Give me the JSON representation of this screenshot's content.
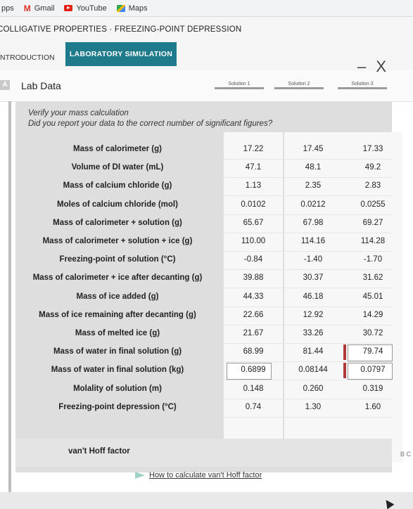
{
  "bookmarks": [
    {
      "label": "pps",
      "icon": "apps-icon"
    },
    {
      "label": "Gmail",
      "icon": "gmail-icon"
    },
    {
      "label": "YouTube",
      "icon": "youtube-icon"
    },
    {
      "label": "Maps",
      "icon": "maps-icon"
    }
  ],
  "app": {
    "title": "COLLIGATIVE PROPERTIES · FREEZING-POINT DEPRESSION",
    "tabs": [
      "NTRODUCTION",
      "LABORATORY SIMULATION"
    ],
    "window_controls": "– X"
  },
  "panel": {
    "title": "Lab Data",
    "trial_headers": [
      "Solution 1",
      "Solution 2",
      "Solution 3"
    ],
    "verify_line1": "Verify your mass calculation",
    "verify_line2": "Did you report your data to the correct number of significant figures?"
  },
  "rows": [
    {
      "label": "Mass of calorimeter (g)",
      "values": [
        "17.22",
        "17.45",
        "17.33"
      ]
    },
    {
      "label": "Volume of DI water (mL)",
      "values": [
        "47.1",
        "48.1",
        "49.2"
      ]
    },
    {
      "label": "Mass of calcium chloride (g)",
      "values": [
        "1.13",
        "2.35",
        "2.83"
      ]
    },
    {
      "label": "Moles of calcium chloride (mol)",
      "values": [
        "0.0102",
        "0.0212",
        "0.0255"
      ]
    },
    {
      "label": "Mass of calorimeter + solution (g)",
      "values": [
        "65.67",
        "67.98",
        "69.27"
      ]
    },
    {
      "label": "Mass of calorimeter + solution + ice (g)",
      "values": [
        "110.00",
        "114.16",
        "114.28"
      ]
    },
    {
      "label": "Freezing-point of solution (°C)",
      "values": [
        "-0.84",
        "-1.40",
        "-1.70"
      ]
    },
    {
      "label": "Mass of calorimeter + ice after decanting (g)",
      "values": [
        "39.88",
        "30.37",
        "31.62"
      ]
    },
    {
      "label": "Mass of ice added (g)",
      "values": [
        "44.33",
        "46.18",
        "45.01"
      ]
    },
    {
      "label": "Mass of ice remaining after decanting (g)",
      "values": [
        "22.66",
        "12.92",
        "14.29"
      ]
    },
    {
      "label": "Mass of melted ice (g)",
      "values": [
        "21.67",
        "33.26",
        "30.72"
      ]
    },
    {
      "label": "Mass of water in final solution (g)",
      "values": [
        "68.99",
        "81.44",
        "79.74"
      ]
    },
    {
      "label": "Mass of water in final solution (kg)",
      "values": [
        "0.6899",
        "0.08144",
        "0.0797"
      ]
    },
    {
      "label": "Molality of solution (m)",
      "values": [
        "0.148",
        "0.260",
        "0.319"
      ]
    },
    {
      "label": "Freezing-point depression (°C)",
      "values": [
        "0.74",
        "1.30",
        "1.60"
      ]
    }
  ],
  "vant_hoff_label": "van't Hoff factor",
  "howto_link": "How to calculate van't Hoff factor",
  "edge_text": "B C",
  "colors": {
    "accent": "#1f7a8c",
    "error": "#b03a3a"
  }
}
